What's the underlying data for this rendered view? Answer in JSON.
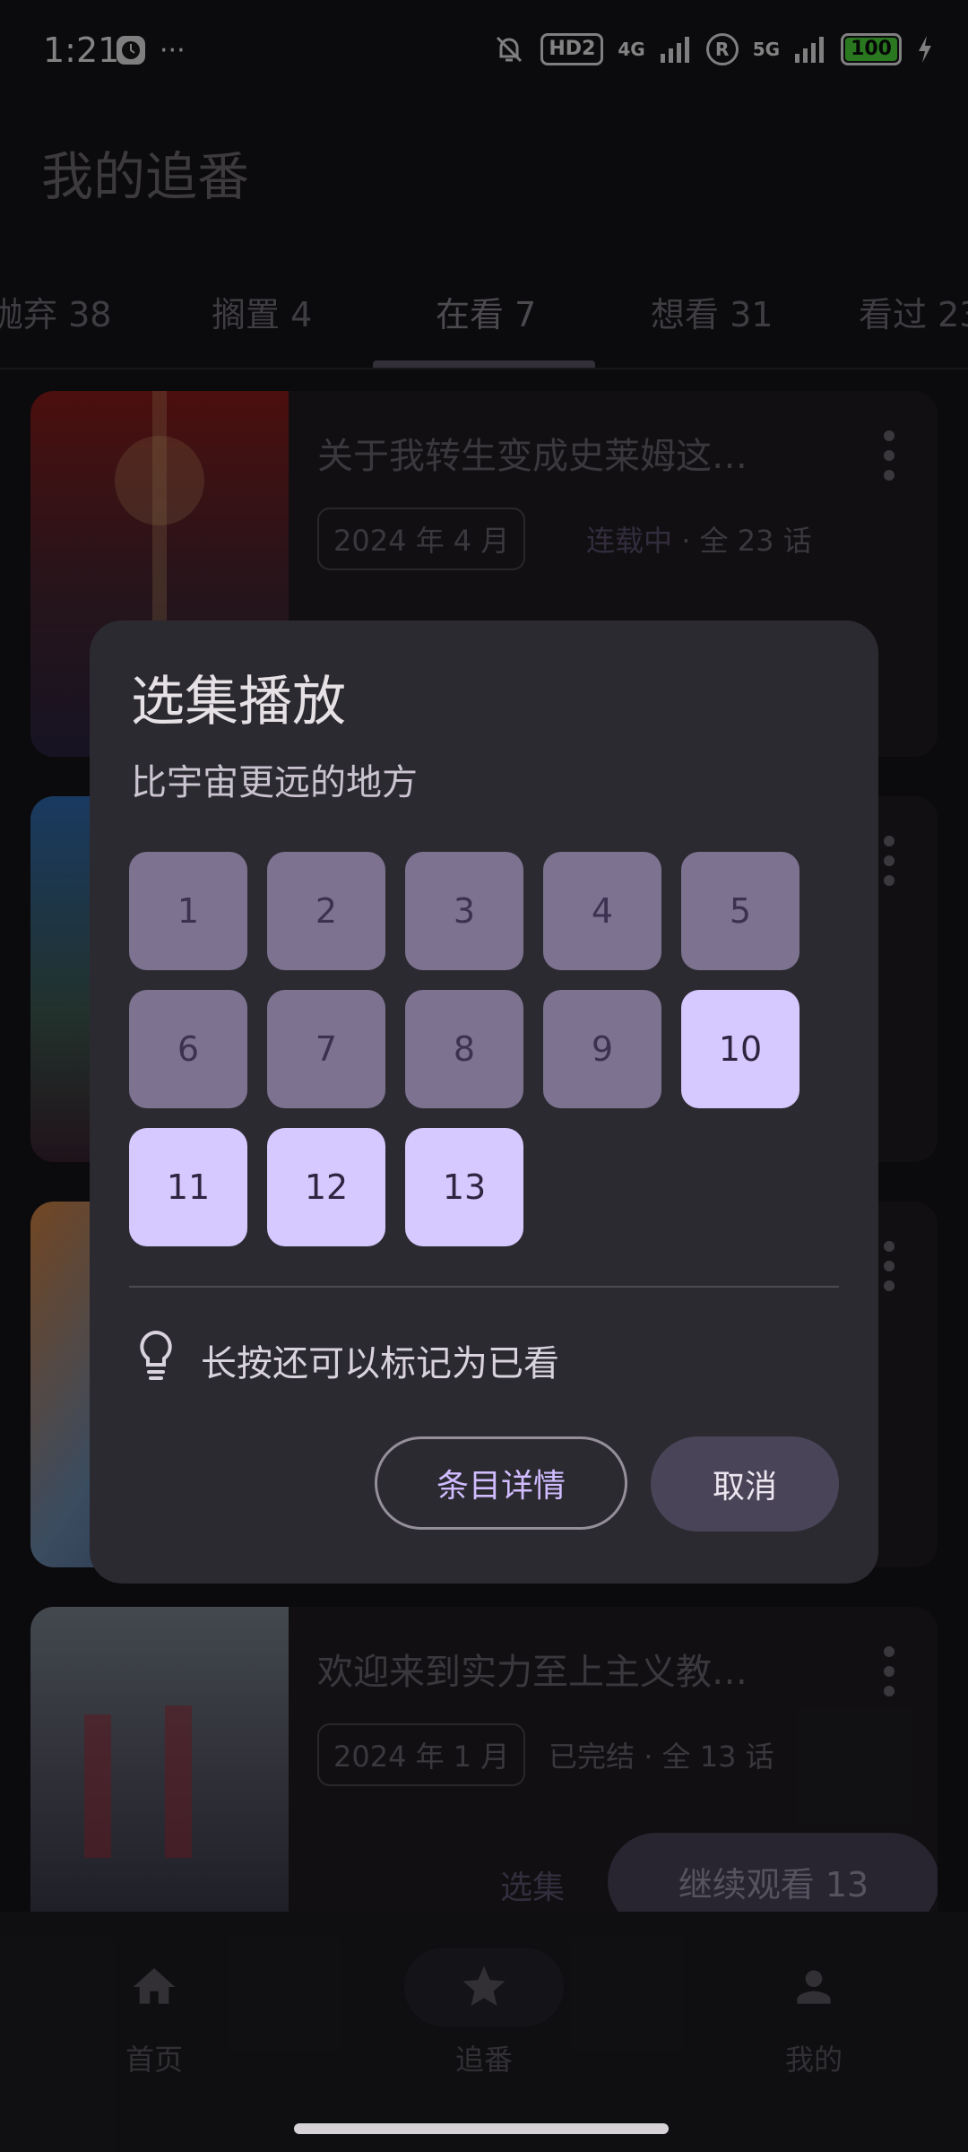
{
  "status_bar": {
    "time": "1:21",
    "more": "···",
    "hd_badge": "HD2",
    "net1": "4G",
    "r_badge": "R",
    "net2": "5G",
    "battery": "100"
  },
  "header": {
    "title": "我的追番"
  },
  "tabs": [
    {
      "label": "抛弃 38"
    },
    {
      "label": "搁置 4"
    },
    {
      "label": "在看 7"
    },
    {
      "label": "想看 31"
    },
    {
      "label": "看过 23"
    }
  ],
  "cards": [
    {
      "title": "关于我转生变成史莱姆这…",
      "date": "2024 年 4 月",
      "status": "连载中",
      "total": "全 23 话"
    },
    {
      "title": "欢迎来到实力至上主义教…",
      "date": "2024 年 1 月",
      "status": "已完结",
      "total": "全 13 话",
      "select": "选集",
      "continue": "继续观看 13"
    }
  ],
  "dialog": {
    "title": "选集播放",
    "subtitle": "比宇宙更远的地方",
    "episodes": [
      "1",
      "2",
      "3",
      "4",
      "5",
      "6",
      "7",
      "8",
      "9",
      "10",
      "11",
      "12",
      "13"
    ],
    "hint": "长按还可以标记为已看",
    "detail_button": "条目详情",
    "cancel_button": "取消"
  },
  "bottom_nav": [
    {
      "label": "首页",
      "icon": "home-icon"
    },
    {
      "label": "追番",
      "icon": "star-icon"
    },
    {
      "label": "我的",
      "icon": "person-icon"
    }
  ],
  "colors": {
    "accent": "#d0bcff",
    "watched_episode": "#7d7390",
    "unwatched_episode": "#d6c9ff",
    "dialog_bg": "#2c2a31"
  }
}
